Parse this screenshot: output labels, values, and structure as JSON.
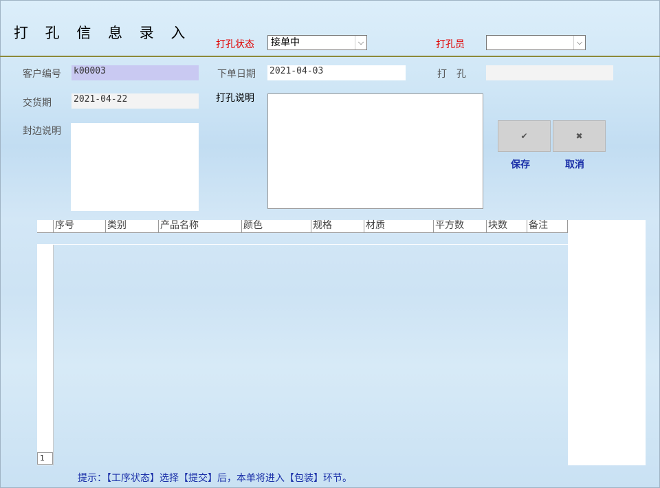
{
  "title": "打 孔 信 息 录 入",
  "status": {
    "label": "打孔状态",
    "value": "接单中"
  },
  "operator": {
    "label": "打孔员",
    "value": ""
  },
  "customer": {
    "label": "客户编号",
    "value": "k00003"
  },
  "order_date": {
    "label": "下单日期",
    "value": "2021-04-03"
  },
  "drill": {
    "label": "打　孔",
    "value": ""
  },
  "delivery": {
    "label": "交货期",
    "value": "2021-04-22"
  },
  "drill_note": {
    "label": "打孔说明"
  },
  "edge_note": {
    "label": "封边说明"
  },
  "buttons": {
    "save": {
      "icon": "✔",
      "label": "保存"
    },
    "cancel": {
      "icon": "✖",
      "label": "取消"
    }
  },
  "grid": {
    "columns": [
      "序号",
      "类别",
      "产品名称",
      "颜色",
      "规格",
      "材质",
      "平方数",
      "块数",
      "备注"
    ],
    "page": "1"
  },
  "hint": "提示：【工序状态】选择【提交】后，本单将进入【包装】环节。"
}
